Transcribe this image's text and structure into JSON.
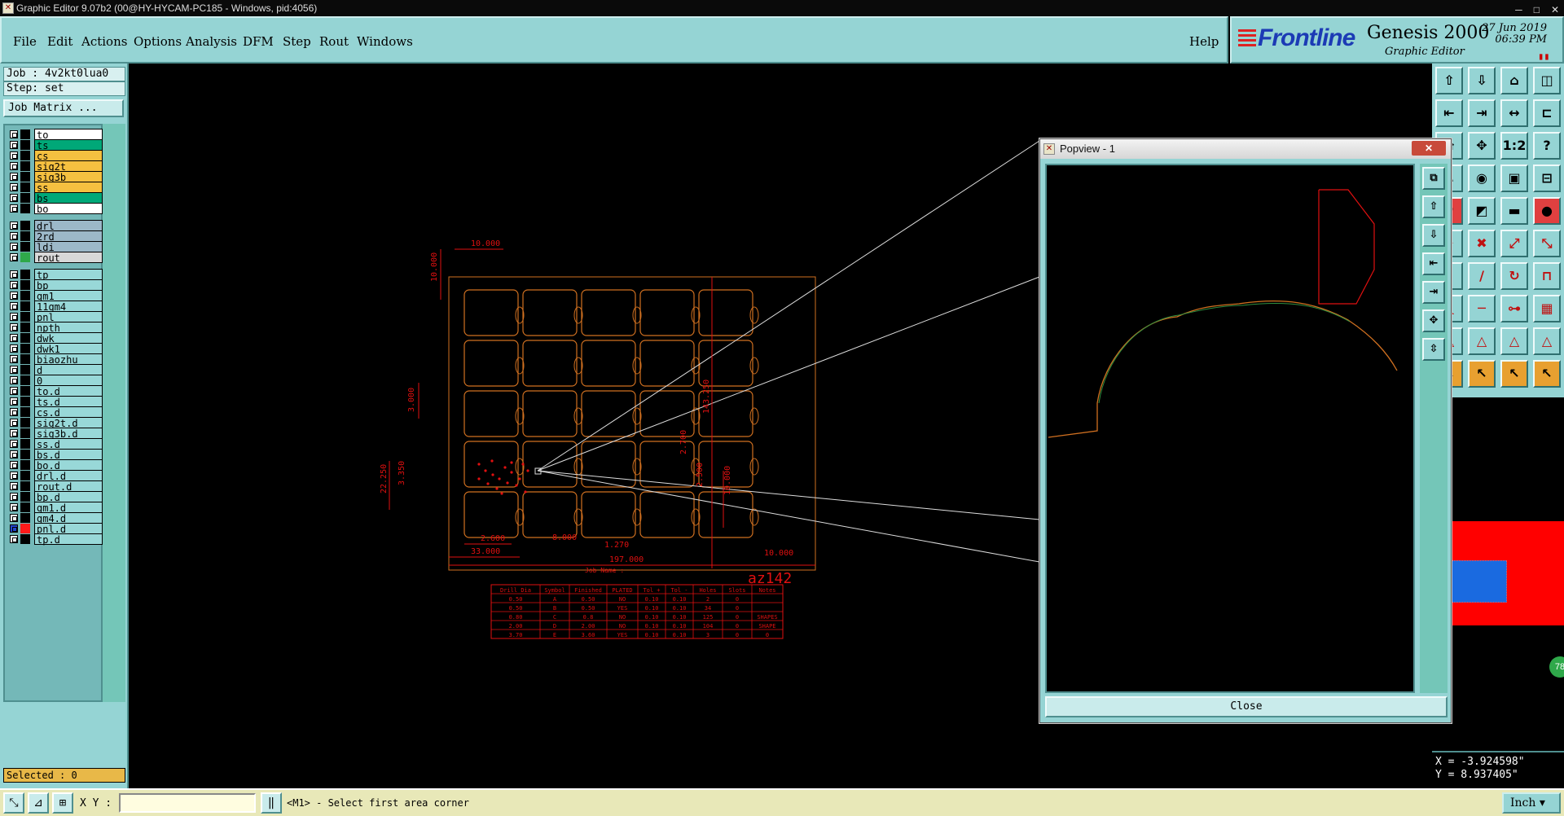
{
  "window": {
    "title": "Graphic Editor 9.07b2 (00@HY-HYCAM-PC185 - Windows, pid:4056)"
  },
  "menu": {
    "items": [
      "File",
      "Edit",
      "Actions",
      "Options",
      "Analysis",
      "DFM",
      "Step",
      "Rout",
      "Windows"
    ],
    "help": "Help"
  },
  "brand": {
    "logo": "Frontline",
    "product": "Genesis 2000",
    "subtitle": "Graphic Editor",
    "date": "27 Jun 2019",
    "time": "06:39 PM"
  },
  "job": {
    "job_label": "Job : 4v2kt0lua0",
    "step_label": "Step: set",
    "matrix_button": "Job Matrix ..."
  },
  "layers": [
    {
      "name": "to",
      "color": "#ffffff"
    },
    {
      "name": "ts",
      "color": "#00a878"
    },
    {
      "name": "cs",
      "color": "#f5c040"
    },
    {
      "name": "sig2t",
      "color": "#f5c040"
    },
    {
      "name": "sig3b",
      "color": "#f5c040"
    },
    {
      "name": "ss",
      "color": "#f5c040"
    },
    {
      "name": "bs",
      "color": "#00a878"
    },
    {
      "name": "bo",
      "color": "#ffffff"
    },
    {
      "name": "drl",
      "color": "#9cb8c8"
    },
    {
      "name": "2rd",
      "color": "#9cb8c8"
    },
    {
      "name": "ldi",
      "color": "#9cb8c8"
    },
    {
      "name": "rout",
      "color": "#d8d8d8"
    },
    {
      "name": "tp",
      "color": "#98d8d8"
    },
    {
      "name": "bp",
      "color": "#98d8d8"
    },
    {
      "name": "gm1",
      "color": "#98d8d8"
    },
    {
      "name": "11gm4",
      "color": "#98d8d8"
    },
    {
      "name": "pnl",
      "color": "#98d8d8"
    },
    {
      "name": "npth",
      "color": "#98d8d8"
    },
    {
      "name": "dwk",
      "color": "#98d8d8"
    },
    {
      "name": "dwk1",
      "color": "#98d8d8"
    },
    {
      "name": "biaozhu",
      "color": "#98d8d8"
    },
    {
      "name": "d",
      "color": "#98d8d8"
    },
    {
      "name": "0",
      "color": "#98d8d8"
    },
    {
      "name": "to.d",
      "color": "#98d8d8"
    },
    {
      "name": "ts.d",
      "color": "#98d8d8"
    },
    {
      "name": "cs.d",
      "color": "#98d8d8"
    },
    {
      "name": "sig2t.d",
      "color": "#98d8d8"
    },
    {
      "name": "sig3b.d",
      "color": "#98d8d8"
    },
    {
      "name": "ss.d",
      "color": "#98d8d8"
    },
    {
      "name": "bs.d",
      "color": "#98d8d8"
    },
    {
      "name": "bo.d",
      "color": "#98d8d8"
    },
    {
      "name": "drl.d",
      "color": "#98d8d8"
    },
    {
      "name": "rout.d",
      "color": "#98d8d8"
    },
    {
      "name": "bp.d",
      "color": "#98d8d8"
    },
    {
      "name": "gm1.d",
      "color": "#98d8d8"
    },
    {
      "name": "gm4.d",
      "color": "#98d8d8"
    },
    {
      "name": "pnl.d",
      "color": "#98d8d8",
      "active": true
    },
    {
      "name": "tp.d",
      "color": "#98d8d8"
    }
  ],
  "selected": "Selected : 0",
  "bottom": {
    "xy_label": "X Y :",
    "xy_value": "",
    "prompt": "<M1> - Select first area corner",
    "units": "Inch"
  },
  "coords": {
    "x": "X = -3.924598\"",
    "y": "Y = 8.937405\""
  },
  "popview": {
    "title": "Popview - 1",
    "close_label": "Close"
  },
  "drawing": {
    "dims": [
      "10.000",
      "10.000",
      "3.000",
      "143.250",
      "22.250",
      "3.350",
      "2.700",
      "2.500",
      "10.000",
      "2.600",
      "33.000",
      "8.000",
      "1.270",
      "197.000",
      "10.000"
    ],
    "job_name_label": "Job Name :",
    "annotation": "az142",
    "table_headers": [
      "Drill Dia",
      "Symbol",
      "Finished",
      "PLATED",
      "Tol +",
      "Tol -",
      "Holes",
      "Slots",
      "Notes"
    ],
    "table_rows": [
      [
        "0.50",
        "A",
        "0.50",
        "NO",
        "0.10",
        "0.10",
        "2",
        "0",
        ""
      ],
      [
        "0.50",
        "B",
        "0.50",
        "YES",
        "0.10",
        "0.10",
        "34",
        "0",
        ""
      ],
      [
        "0.80",
        "C",
        "0.8",
        "NO",
        "0.10",
        "0.10",
        "125",
        "0",
        "SHAPES"
      ],
      [
        "2.00",
        "D",
        "2.00",
        "NO",
        "0.10",
        "0.10",
        "104",
        "0",
        "SHAPE"
      ],
      [
        "3.70",
        "E",
        "3.60",
        "YES",
        "0.10",
        "0.10",
        "3",
        "0",
        "0"
      ]
    ]
  },
  "colors": {
    "panel": "#95d4d4",
    "drawing": "#e01010",
    "outline": "#d07020"
  }
}
